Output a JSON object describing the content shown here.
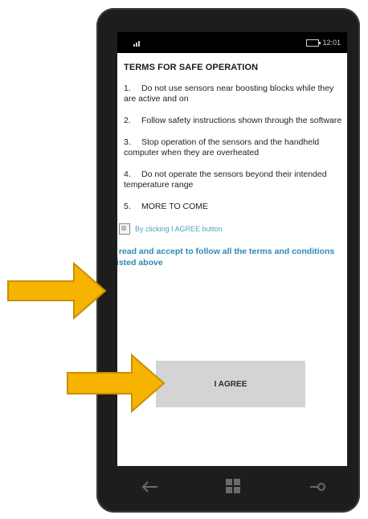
{
  "status_bar": {
    "signal": "signal-icon",
    "time": "12:01"
  },
  "terms": {
    "title": "TERMS FOR SAFE OPERATION",
    "items": [
      {
        "number": "1.",
        "text": "Do not use sensors near boosting blocks while they are active and on"
      },
      {
        "number": "2.",
        "text": "Follow safety instructions shown through the software"
      },
      {
        "number": "3.",
        "text": "Stop operation of the sensors and the handheld computer when they are overheated"
      },
      {
        "number": "4.",
        "text": "Do not operate the sensors beyond their intended temperature range"
      },
      {
        "number": "5.",
        "text": "MORE TO COME"
      }
    ]
  },
  "agreement": {
    "checkbox_label": "By clicking I AGREE button",
    "accept_text": "I read and accept to follow all the terms and conditions listed above",
    "agree_button": "I AGREE"
  },
  "nav": {
    "back": "back-arrow-icon",
    "home": "windows-icon",
    "search": "search-icon"
  },
  "colors": {
    "link_blue": "#2d8ab2",
    "button_gray": "#d4d4d4",
    "arrow_orange": "#f6b400",
    "phone_frame": "#1d1d1d"
  }
}
